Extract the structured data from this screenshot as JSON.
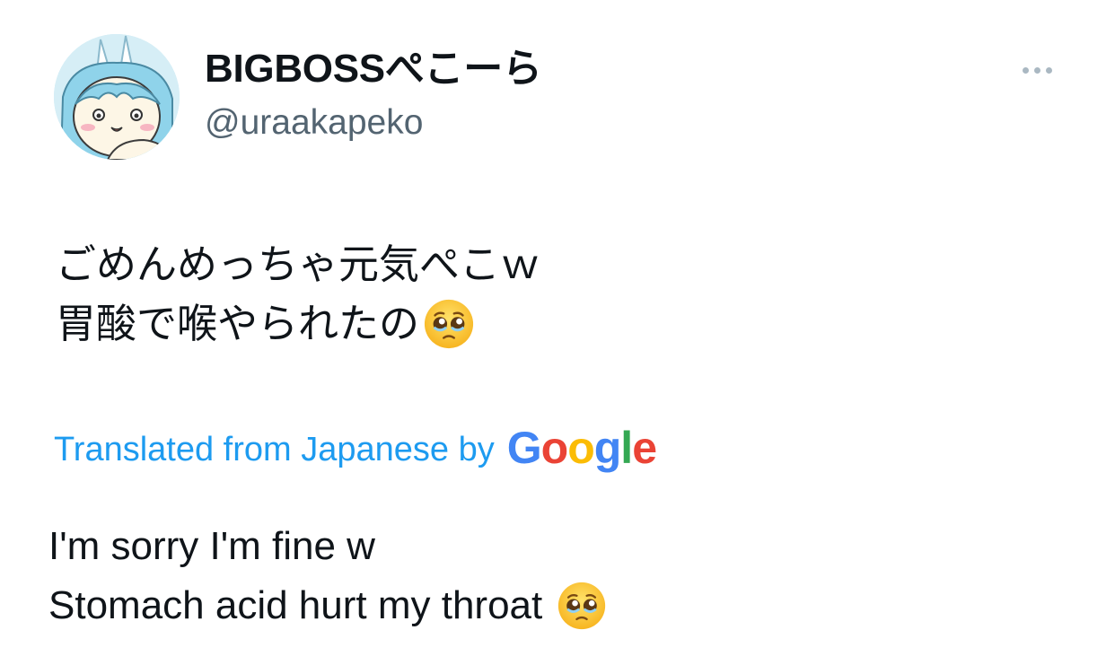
{
  "author": {
    "display_name": "BIGBOSSぺこーら",
    "handle": "@uraakapeko",
    "avatar_icon": "rabbit-girl-avatar-icon"
  },
  "more_icon": "more-options-icon",
  "tweet": {
    "lines": [
      "ごめんめっちゃ元気ぺこｗ",
      "胃酸で喉やられたの"
    ],
    "emoji": "pleading-face-emoji"
  },
  "translation": {
    "label": "Translated from Japanese by",
    "provider_letters": [
      "G",
      "o",
      "o",
      "g",
      "l",
      "e"
    ],
    "provider_colors": [
      "#4285f4",
      "#ea4335",
      "#fbbc05",
      "#4285f4",
      "#34a853",
      "#ea4335"
    ],
    "lines": [
      "I'm sorry I'm fine w",
      "Stomach acid hurt my throat"
    ],
    "emoji": "pleading-face-emoji"
  },
  "colors": {
    "link": "#1d9bf0",
    "handle": "#536471",
    "text": "#0f1419"
  }
}
